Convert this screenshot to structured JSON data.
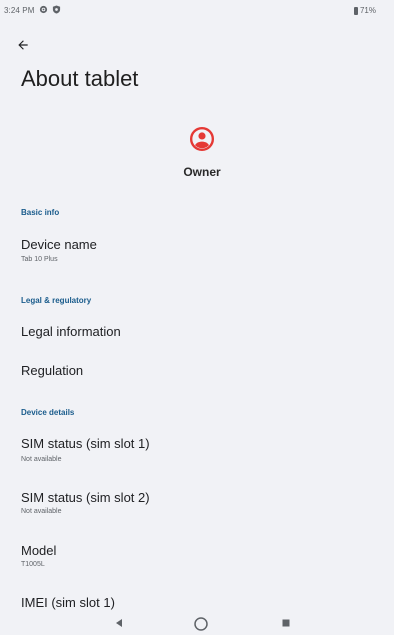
{
  "status_bar": {
    "time": "3:24 PM",
    "battery": "71%"
  },
  "page": {
    "title": "About tablet"
  },
  "owner": {
    "name": "Owner"
  },
  "sections": {
    "basic_info": "Basic info",
    "legal": "Legal & regulatory",
    "device_details": "Device details"
  },
  "items": {
    "device_name": {
      "title": "Device name",
      "summary": "Tab 10 Plus"
    },
    "legal_information": {
      "title": "Legal information"
    },
    "regulation": {
      "title": "Regulation"
    },
    "sim_status_1": {
      "title": "SIM status (sim slot 1)",
      "summary": "Not available"
    },
    "sim_status_2": {
      "title": "SIM status (sim slot 2)",
      "summary": "Not available"
    },
    "model": {
      "title": "Model",
      "summary": "T1005L"
    },
    "imei_1": {
      "title": "IMEI (sim slot 1)"
    }
  },
  "colors": {
    "accent": "#e53935",
    "section_header": "#1a5c8c",
    "background": "#f1f2f6"
  },
  "icons": {
    "back": "arrow-back-icon",
    "avatar": "account-circle-icon",
    "settings_status": "gear-icon",
    "shield_status": "shield-icon",
    "battery": "battery-icon",
    "nav_back": "triangle-back-icon",
    "nav_home": "circle-home-icon",
    "nav_recents": "square-recents-icon"
  }
}
